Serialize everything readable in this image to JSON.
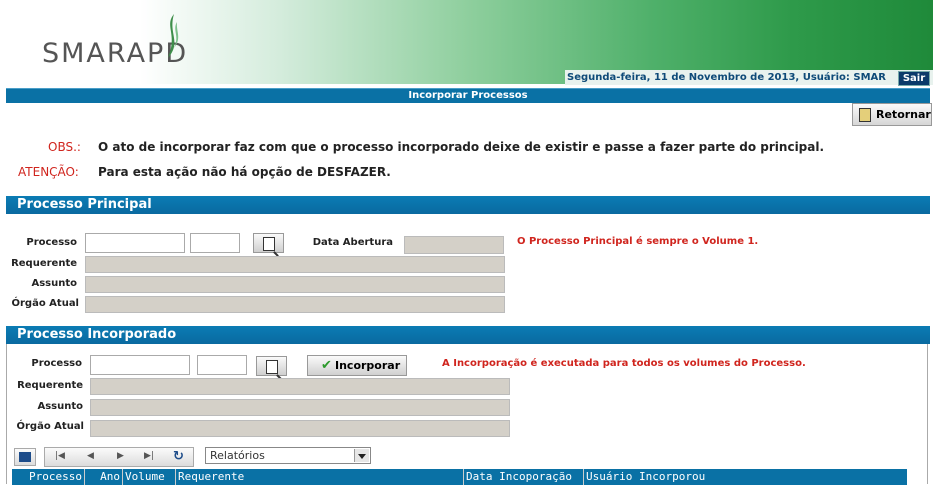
{
  "header": {
    "logo_text": "SMARAPD",
    "date_user": "Segunda-feira, 11 de Novembro de 2013, Usuário: SMAR",
    "logout_label": "Sair"
  },
  "page_title": "Incorporar Processos",
  "toolbar": {
    "return_label": "Retornar"
  },
  "notes": {
    "obs_key": "OBS.:",
    "obs_text": "O ato de incorporar faz com que o processo incorporado deixe de existir e passe a fazer parte do principal.",
    "warn_key": "ATENÇÃO:",
    "warn_text": "Para esta ação não há opção de DESFAZER."
  },
  "principal": {
    "title": "Processo Principal",
    "processo_label": "Processo",
    "processo_value": "",
    "ano_value": "",
    "data_abertura_label": "Data Abertura",
    "data_abertura_value": "",
    "requerente_label": "Requerente",
    "assunto_label": "Assunto",
    "orgao_label": "Órgão Atual",
    "info": "O Processo Principal é sempre o Volume 1."
  },
  "incorporado": {
    "title": "Processo Incorporado",
    "processo_label": "Processo",
    "processo_value": "",
    "ano_value": "",
    "incorporar_label": "Incorporar",
    "requerente_label": "Requerente",
    "assunto_label": "Assunto",
    "orgao_label": "Órgão Atual",
    "info": "A Incorporação é executada para todos os volumes do Processo."
  },
  "grid": {
    "reports_selected": "Relatórios",
    "columns": [
      "Processo",
      "Ano",
      "Volume",
      "Requerente",
      "Data Incoporação",
      "Usuário Incorporou"
    ]
  },
  "colors": {
    "accent_blue": "#0a71a5",
    "warning_red": "#d0251e",
    "brand_green": "#1f8a3a"
  }
}
